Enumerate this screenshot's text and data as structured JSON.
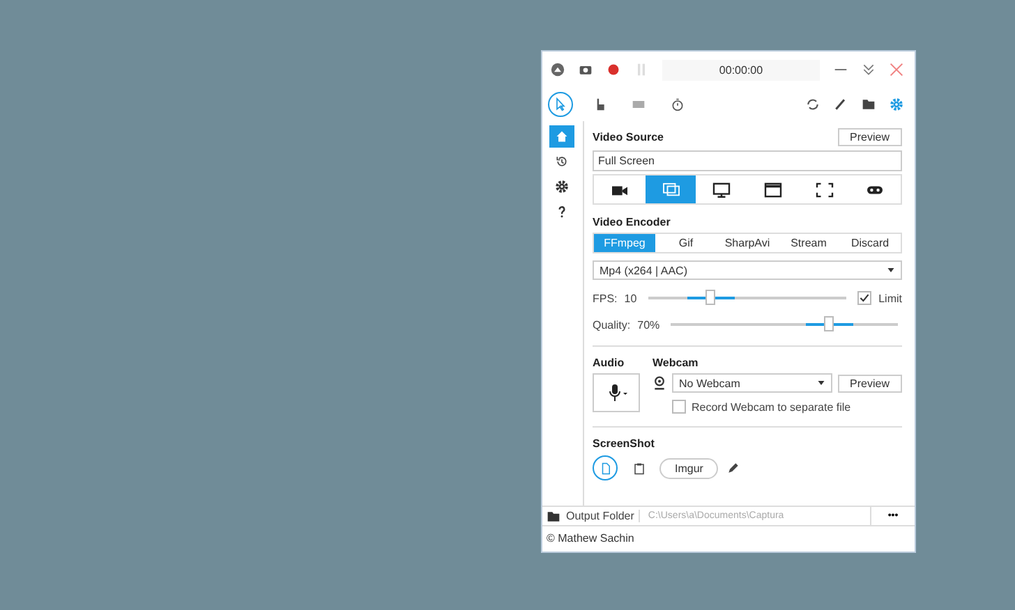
{
  "title_bar": {
    "timer": "00:00:00"
  },
  "tools": [
    {
      "kind": "cursor",
      "selected": true
    },
    {
      "kind": "click",
      "selected": false
    },
    {
      "kind": "keys",
      "selected": false
    },
    {
      "kind": "timer",
      "selected": false
    }
  ],
  "sidebar": [
    {
      "kind": "home",
      "selected": true
    },
    {
      "kind": "history",
      "selected": false
    },
    {
      "kind": "settings",
      "selected": false
    },
    {
      "kind": "help",
      "selected": false
    }
  ],
  "video_source": {
    "heading": "Video Source",
    "preview_button": "Preview",
    "source": "Full Screen",
    "sources": [
      {
        "kind": "camera",
        "selected": false
      },
      {
        "kind": "screen",
        "selected": true
      },
      {
        "kind": "monitor",
        "selected": false
      },
      {
        "kind": "window",
        "selected": false
      },
      {
        "kind": "region",
        "selected": false
      },
      {
        "kind": "gamepad",
        "selected": false
      }
    ]
  },
  "video_encoder": {
    "heading": "Video Encoder",
    "tabs": [
      {
        "label": "FFmpeg",
        "selected": true
      },
      {
        "label": "Gif",
        "selected": false
      },
      {
        "label": "SharpAvi",
        "selected": false
      },
      {
        "label": "Stream",
        "selected": false
      },
      {
        "label": "Discard",
        "selected": false
      }
    ],
    "format": "Mp4 (x264 | AAC)",
    "fps_label": "FPS:",
    "fps_value": "10",
    "fps": {
      "level": 0.32
    },
    "limit": {
      "label": "Limit",
      "checked": true
    },
    "quality_label": "Quality:",
    "quality_value": "70%",
    "quality": {
      "level": 0.7
    }
  },
  "audio": {
    "heading": "Audio"
  },
  "webcam": {
    "heading": "Webcam",
    "device": "No Webcam",
    "preview_button": "Preview",
    "separate_file": {
      "label": "Record Webcam to separate file",
      "checked": false
    }
  },
  "screenshot": {
    "heading": "ScreenShot",
    "targets": [
      {
        "kind": "file",
        "selected": true
      },
      {
        "kind": "clipboard",
        "selected": false
      },
      {
        "kind": "imgur",
        "label": "Imgur",
        "selected": false
      }
    ]
  },
  "output": {
    "label": "Output Folder",
    "path": "C:\\Users\\a\\Documents\\Captura",
    "more_button": "•••"
  },
  "footer": "© Mathew Sachin"
}
